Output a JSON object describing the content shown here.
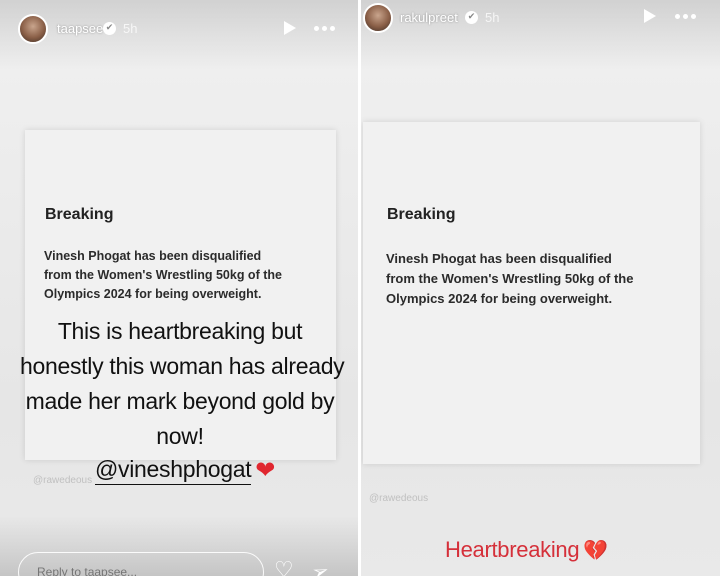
{
  "left_story": {
    "username": "taapsee",
    "timestamp": "5h",
    "card_heading": "Breaking",
    "card_body_lines": [
      "Vinesh Phogat has been disqualified",
      "from the Women's Wrestling 50kg of the",
      "Olympics 2024 for being overweight."
    ],
    "caption_lines": [
      "This is heartbreaking but",
      "honestly this woman has already",
      "made her mark beyond gold by",
      "now!"
    ],
    "mention": "@vineshphogat",
    "mention_emoji": "❤",
    "watermark": "@rawedeous",
    "reply_placeholder": "Reply to taapsee..."
  },
  "right_story": {
    "username": "rakulpreet",
    "timestamp": "5h",
    "card_heading": "Breaking",
    "card_body_lines": [
      "Vinesh Phogat has been disqualified",
      "from the Women's Wrestling 50kg of the",
      "Olympics 2024 for being overweight."
    ],
    "watermark": "@rawedeous",
    "caption": "Heartbreaking",
    "caption_emoji": "💔"
  },
  "icons": {
    "verified": "✔",
    "play": "play-icon",
    "more": "more-icon",
    "like": "♡",
    "send": "➢"
  },
  "colors": {
    "caption_red": "#d5303a",
    "heart_red": "#e0262f"
  }
}
